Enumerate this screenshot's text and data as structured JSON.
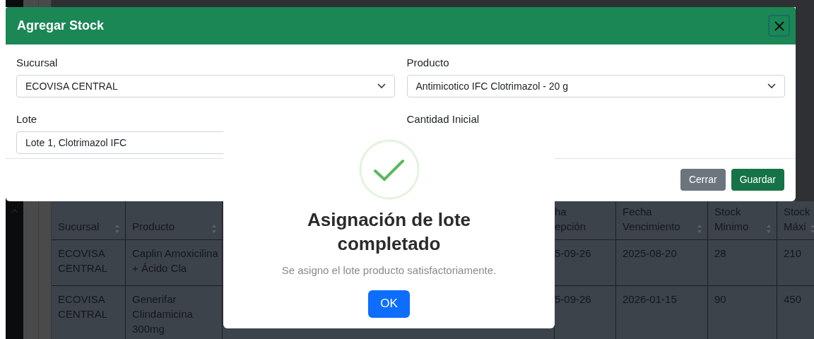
{
  "table": {
    "columns": [
      "Sucursal",
      "Producto",
      "ha\nepción",
      "Fecha\nVencimiento",
      "Stock\nMinimo",
      "Stock\nMáxi"
    ],
    "rows": [
      [
        "ECOVISA\nCENTRAL",
        "Caplin Amoxicilina\n+ Ácido Cla",
        "5-09-26",
        "2025-08-20",
        "28",
        "210"
      ],
      [
        "ECOVISA\nCENTRAL",
        "Generifar\nClindamicina\n300mg",
        "5-09-26",
        "2026-01-15",
        "90",
        "450"
      ]
    ]
  },
  "form_modal": {
    "title": "Agregar Stock",
    "fields": [
      {
        "label": "Sucursal",
        "kind": "select",
        "value": "ECOVISA CENTRAL"
      },
      {
        "label": "Producto",
        "kind": "select",
        "value": "Antimicotico IFC Clotrimazol - 20 g"
      },
      {
        "label": "Lote",
        "kind": "input",
        "value": "Lote 1, Clotrimazol IFC"
      },
      {
        "label": "Cantidad Inicial",
        "kind": "hidden"
      }
    ],
    "buttons": [
      {
        "label": "Cerrar",
        "kind": "secondary"
      },
      {
        "label": "Guardar",
        "kind": "primary"
      }
    ]
  },
  "alert": {
    "title": "Asignación de lote completado",
    "text": "Se asigno el lote producto satisfactoriamente.",
    "button": "OK"
  }
}
